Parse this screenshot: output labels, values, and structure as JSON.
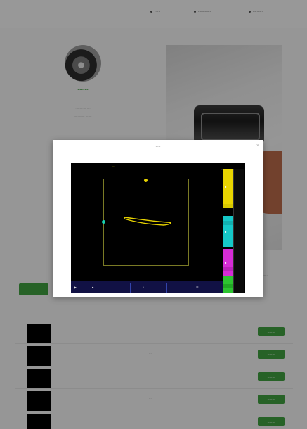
{
  "topnav": {
    "items": [
      {
        "label": "......",
        "icon": "dot-icon"
      },
      {
        "label": "..............",
        "icon": "dot-icon"
      },
      {
        "label": "...........",
        "icon": "dot-icon"
      }
    ]
  },
  "profile": {
    "name": "...........",
    "lines": [
      "............ ....",
      "...... ..... ....",
      "............ ......."
    ]
  },
  "background": {
    "caption": "........",
    "new_button": "........"
  },
  "table": {
    "columns": [
      "......",
      "........",
      "........"
    ],
    "rows": [
      {
        "value": "....",
        "action": "........"
      },
      {
        "value": "....",
        "action": "........"
      },
      {
        "value": "....",
        "action": "........"
      },
      {
        "value": "....",
        "action": "........"
      },
      {
        "value": "....",
        "action": "........"
      }
    ]
  },
  "modal": {
    "title": ".....",
    "close_icon": "close-icon"
  },
  "scope": {
    "status": "........",
    "status_2": "....",
    "top_right": "....",
    "channels": [
      {
        "name": "channel-1",
        "color": "#e9d500"
      },
      {
        "name": "channel-2",
        "color": "#15c8c8"
      },
      {
        "name": "channel-3",
        "color": "#d62cd6"
      },
      {
        "name": "channel-4",
        "color": "#2dc430"
      }
    ],
    "bottom": {
      "left": "..",
      "mid": "...",
      "right": "....."
    }
  },
  "colors": {
    "accent_green": "#3f9e3f",
    "trace_yellow": "#e8d300"
  }
}
